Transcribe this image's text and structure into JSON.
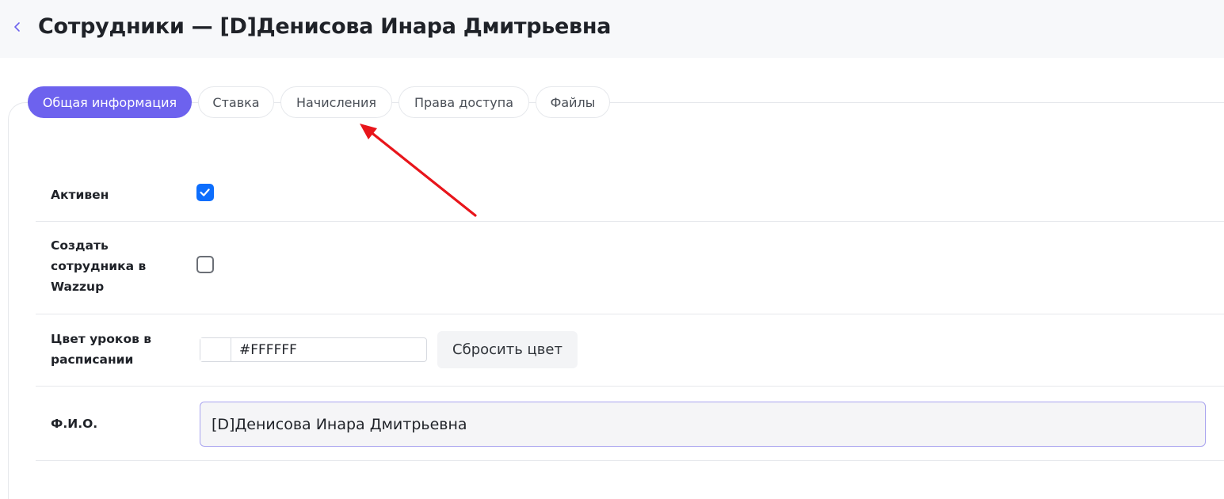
{
  "header": {
    "back_icon": "chevron-left-icon",
    "title": "Сотрудники — [D]Денисова Инара Дмитрьевна"
  },
  "tabs": [
    {
      "label": "Общая информация",
      "active": true
    },
    {
      "label": "Ставка",
      "active": false
    },
    {
      "label": "Начисления",
      "active": false
    },
    {
      "label": "Права доступа",
      "active": false
    },
    {
      "label": "Файлы",
      "active": false
    }
  ],
  "form": {
    "active": {
      "label": "Активен",
      "checked": true
    },
    "wazzup": {
      "label": "Создать сотрудника в Wazzup",
      "checked": false
    },
    "lesson_color": {
      "label": "Цвет уроков в расписании",
      "value": "#FFFFFF",
      "reset_label": "Сбросить цвет"
    },
    "fio": {
      "label": "Ф.И.О.",
      "value": "[D]Денисова Инара Дмитрьевна"
    }
  },
  "colors": {
    "accent": "#6d62ee",
    "checkbox": "#0d6efd",
    "annotation_arrow": "#e8151b",
    "swatch": "#FFFFFF"
  }
}
